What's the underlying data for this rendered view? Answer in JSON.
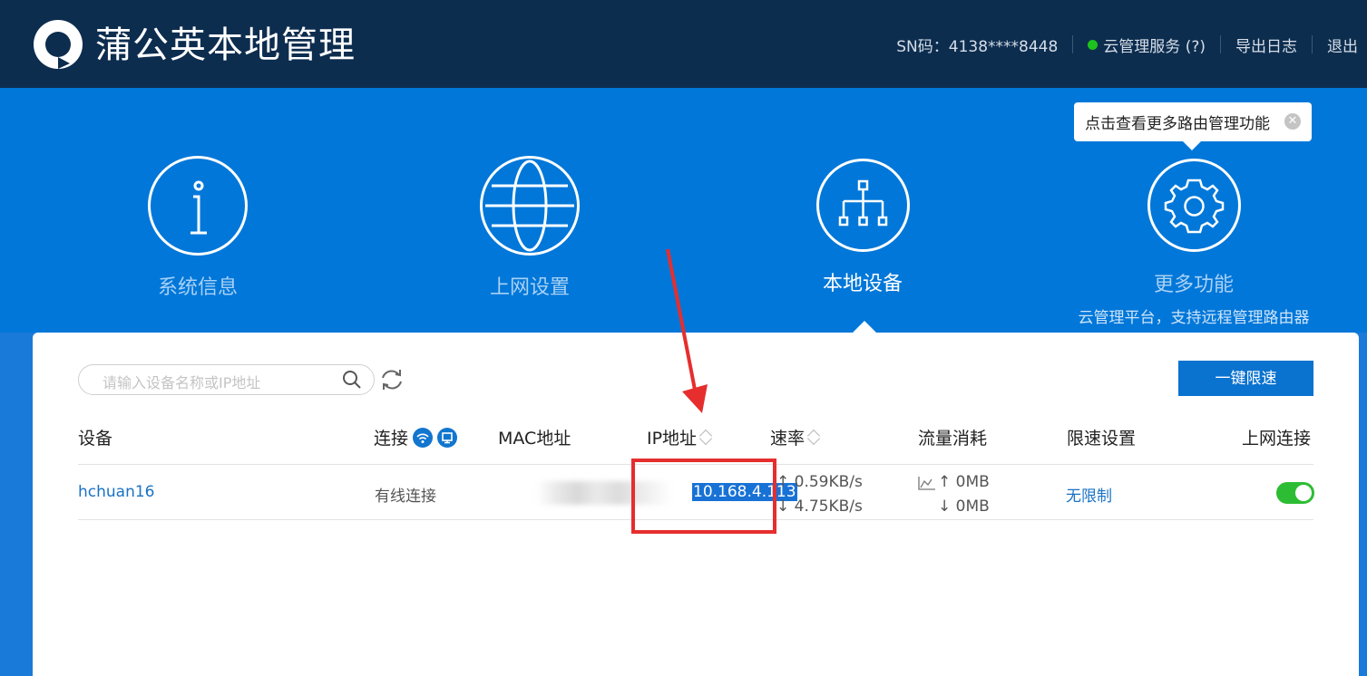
{
  "header": {
    "app_title": "蒲公英本地管理",
    "sn": "SN码：4138****8448",
    "cloud_service": "云管理服务 (?)",
    "export_log": "导出日志",
    "logout": "退出"
  },
  "nav": {
    "items": [
      {
        "label": "系统信息",
        "icon": "info-icon"
      },
      {
        "label": "上网设置",
        "icon": "globe-icon"
      },
      {
        "label": "本地设备",
        "icon": "network-tree-icon",
        "active": true
      },
      {
        "label": "更多功能",
        "icon": "gear-icon",
        "subtitle": "云管理平台，支持远程管理路由器"
      }
    ],
    "tooltip": "点击查看更多路由管理功能",
    "tooltip_close": "✕"
  },
  "toolbar": {
    "search_placeholder": "请输入设备名称或IP地址",
    "speed_limit_all": "一键限速"
  },
  "table": {
    "headers": {
      "device": "设备",
      "connection": "连接",
      "mac": "MAC地址",
      "ip": "IP地址",
      "rate": "速率",
      "traffic": "流量消耗",
      "speed_setting": "限速设置",
      "internet": "上网连接"
    },
    "rows": [
      {
        "device": "hchuan16",
        "connection": "有线连接",
        "mac": "",
        "ip": "10.168.4.113",
        "rate_up": "↑ 0.59KB/s",
        "rate_down": "↓ 4.75KB/s",
        "traffic_up": "↑ 0MB",
        "traffic_down": "↓ 0MB",
        "speed_setting": "无限制",
        "internet_enabled": true
      }
    ]
  },
  "colors": {
    "topbar": "#0d2d4f",
    "nav_bg": "#0077d9",
    "primary_button": "#0a72cf",
    "toggle_on": "#2dbd34",
    "annotation": "#e62e2e",
    "selection": "#1872d6"
  }
}
